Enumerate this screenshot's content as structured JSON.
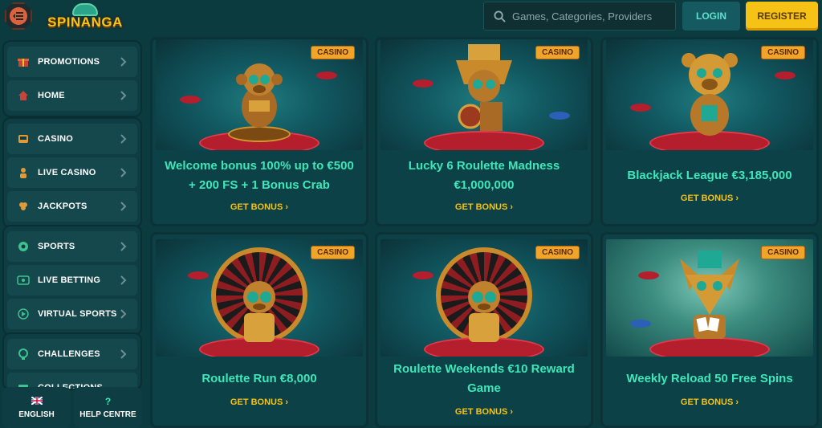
{
  "header": {
    "logo_text": "SPINANGA",
    "search_placeholder": "Games, Categories, Providers",
    "login_label": "LOGIN",
    "register_label": "REGISTER"
  },
  "sidebar": {
    "groups": [
      {
        "items": [
          {
            "label": "PROMOTIONS",
            "icon": "gift-icon"
          },
          {
            "label": "HOME",
            "icon": "home-icon"
          }
        ]
      },
      {
        "items": [
          {
            "label": "CASINO",
            "icon": "slot-machine-icon"
          },
          {
            "label": "LIVE CASINO",
            "icon": "dealer-icon"
          },
          {
            "label": "JACKPOTS",
            "icon": "clover-icon"
          }
        ]
      },
      {
        "items": [
          {
            "label": "SPORTS",
            "icon": "soccer-ball-icon"
          },
          {
            "label": "LIVE BETTING",
            "icon": "live-icon"
          },
          {
            "label": "VIRTUAL SPORTS",
            "icon": "play-icon"
          }
        ]
      },
      {
        "items": [
          {
            "label": "CHALLENGES",
            "icon": "trophy-icon"
          },
          {
            "label": "COLLECTIONS",
            "icon": "collection-icon"
          }
        ]
      }
    ],
    "bottom": {
      "language_label": "ENGLISH",
      "help_label": "HELP CENTRE"
    }
  },
  "cards": [
    {
      "tag": "CASINO",
      "title_line1": "Welcome bonus 100% up to €500",
      "title_line2": "+ 200 FS + 1 Bonus Crab",
      "cta": "GET BONUS",
      "mascot": "monkey"
    },
    {
      "tag": "CASINO",
      "title_line1": "Lucky 6 Roulette Madness",
      "title_line2": "€1,000,000",
      "cta": "GET BONUS",
      "mascot": "idol"
    },
    {
      "tag": "CASINO",
      "title_line1": "Blackjack League €3,185,000",
      "title_line2": "",
      "cta": "GET BONUS",
      "mascot": "bear"
    },
    {
      "tag": "CASINO",
      "title_line1": "Roulette Run €8,000",
      "title_line2": "",
      "cta": "GET BONUS",
      "mascot": "roulette-idol"
    },
    {
      "tag": "CASINO",
      "title_line1": "Roulette Weekends €10 Reward",
      "title_line2": "Game",
      "cta": "GET BONUS",
      "mascot": "roulette-idol"
    },
    {
      "tag": "CASINO",
      "title_line1": "Weekly Reload 50 Free Spins",
      "title_line2": "",
      "cta": "GET BONUS",
      "mascot": "fox"
    }
  ],
  "colors": {
    "background": "#0b3a3f",
    "accent_yellow": "#f5c215",
    "title_green": "#3ee6b9",
    "login_bg": "#155a61",
    "tag_orange": "#f0a42a"
  }
}
